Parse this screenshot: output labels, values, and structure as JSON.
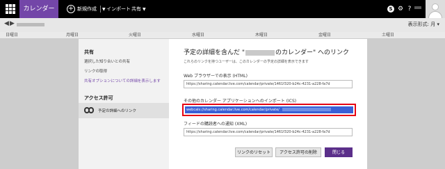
{
  "topbar": {
    "brand": "カレンダー",
    "new_label": "新規作成",
    "import_label": "インポート",
    "share_label": "共有"
  },
  "calnav": {
    "view_mode": "表示形式: 月"
  },
  "weekdays": [
    "日曜日",
    "月曜日",
    "火曜日",
    "水曜日",
    "木曜日",
    "金曜日",
    "土曜日"
  ],
  "sidebar": {
    "share_heading": "共有",
    "share_items": [
      "選択した知り合いとの共有",
      "リンクの取得",
      "共有オプションについての詳細を表示します"
    ],
    "access_heading": "アクセス許可",
    "access_item": "予定の詳細へのリンク"
  },
  "dialog": {
    "title_prefix": "予定の詳細を含んだ \"",
    "title_suffix": "のカレンダー\" へのリンク",
    "description": "これらのリンクを持つユーザーは、このカレンダーの予定の詳細を表示できます",
    "html_label": "Web ブラウザーでの表示 (HTML)",
    "html_value": "https://sharing.calendar.live.com/calendar/private/1461f320-b24c-4231-a228-fa7d",
    "ics_label": "その他のカレンダー アプリケーションへのインポート (ICS)",
    "ics_value": "webcals://sharing.calendar.live.com/calendar/private/",
    "xml_label": "フィードの購読者への通知 (XML)",
    "xml_value": "https://sharing.calendar.live.com/calendar/private/1461f320-b24c-4231-a228-fa7d",
    "reset_button": "リンクのリセット",
    "remove_button": "アクセス許可の削除",
    "close_button": "閉じる"
  },
  "colors": {
    "brand": "#7346a8",
    "primary_button": "#5b2f8a",
    "highlight": "#e60012",
    "selection": "#3a5fd6"
  }
}
